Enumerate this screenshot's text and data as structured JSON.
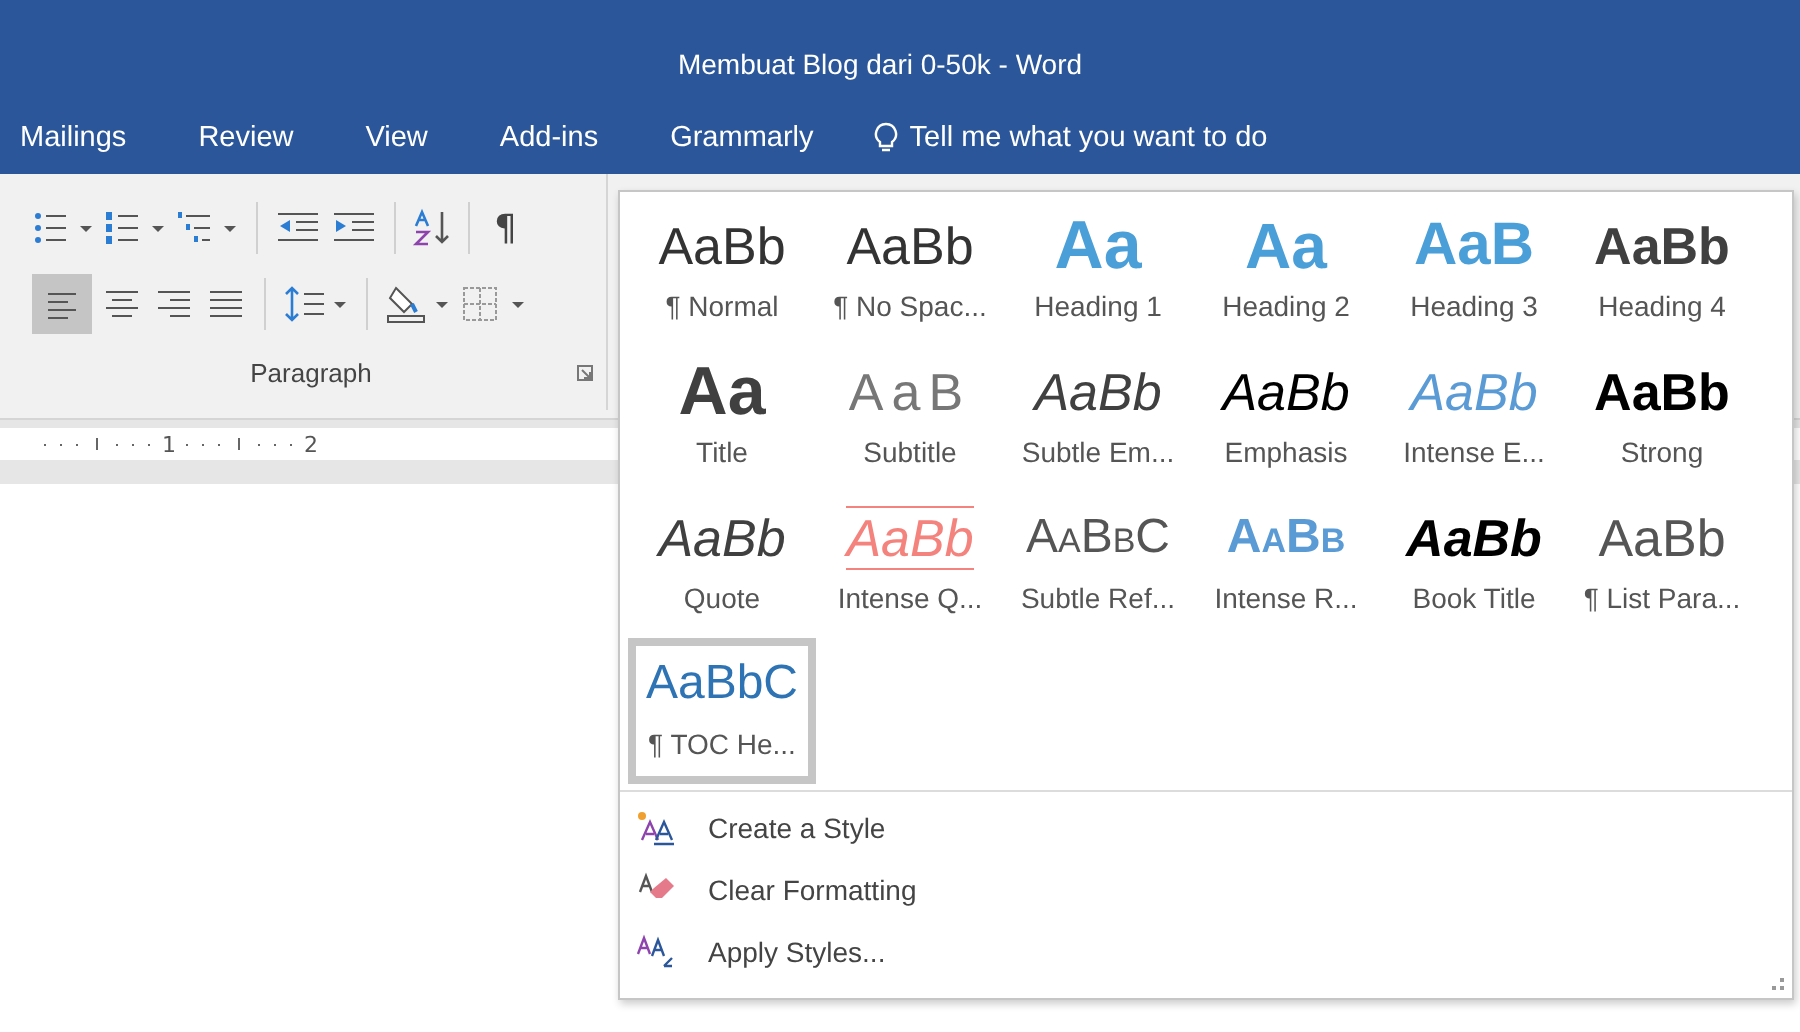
{
  "window": {
    "title": "Membuat Blog dari 0-50k - Word"
  },
  "tabs": [
    {
      "label": "Mailings",
      "selected": false
    },
    {
      "label": "Review",
      "selected": false
    },
    {
      "label": "View",
      "selected": false
    },
    {
      "label": "Add-ins",
      "selected": false
    },
    {
      "label": "Grammarly",
      "selected": false
    }
  ],
  "tell_me": {
    "placeholder": "Tell me what you want to do"
  },
  "paragraph_group": {
    "label": "Paragraph",
    "show_marks": "¶",
    "align_left_selected": true
  },
  "ruler": {
    "marks": [
      "1",
      "2"
    ]
  },
  "styles_gallery": {
    "styles": [
      {
        "preview": "AaBb",
        "label": "¶ Normal",
        "kind": "normal",
        "selected": false
      },
      {
        "preview": "AaBb",
        "label": "¶ No Spac...",
        "kind": "nospacing",
        "selected": false
      },
      {
        "preview": "Aa",
        "label": "Heading 1",
        "kind": "h1",
        "selected": false
      },
      {
        "preview": "Aa",
        "label": "Heading 2",
        "kind": "h2",
        "selected": false
      },
      {
        "preview": "AaB",
        "label": "Heading 3",
        "kind": "h3",
        "selected": false
      },
      {
        "preview": "AaBb",
        "label": "Heading 4",
        "kind": "h4",
        "selected": false
      },
      {
        "preview": "Aa",
        "label": "Title",
        "kind": "title",
        "selected": false
      },
      {
        "preview": "AaB",
        "label": "Subtitle",
        "kind": "subtitle",
        "selected": false
      },
      {
        "preview": "AaBb",
        "label": "Subtle Em...",
        "kind": "subtleem",
        "selected": false
      },
      {
        "preview": "AaBb",
        "label": "Emphasis",
        "kind": "emphasis",
        "selected": false
      },
      {
        "preview": "AaBb",
        "label": "Intense E...",
        "kind": "intenseem",
        "selected": false
      },
      {
        "preview": "AaBb",
        "label": "Strong",
        "kind": "strong",
        "selected": false
      },
      {
        "preview": "AaBb",
        "label": "Quote",
        "kind": "quote",
        "selected": false
      },
      {
        "preview": "AaBb",
        "label": "Intense Q...",
        "kind": "intenseq",
        "selected": false
      },
      {
        "preview": "AaBbC",
        "label": "Subtle Ref...",
        "kind": "subtleref",
        "selected": false
      },
      {
        "preview": "AaBb",
        "label": "Intense R...",
        "kind": "intenseref",
        "selected": false
      },
      {
        "preview": "AaBb",
        "label": "Book Title",
        "kind": "booktitle",
        "selected": false
      },
      {
        "preview": "AaBb",
        "label": "¶ List Para...",
        "kind": "listpara",
        "selected": false
      },
      {
        "preview": "AaBbC",
        "label": "¶ TOC He...",
        "kind": "toc",
        "selected": true
      }
    ],
    "commands": [
      {
        "label": "Create a Style",
        "kind": "create"
      },
      {
        "label": "Clear Formatting",
        "kind": "clear"
      },
      {
        "label": "Apply Styles...",
        "kind": "apply"
      }
    ]
  }
}
